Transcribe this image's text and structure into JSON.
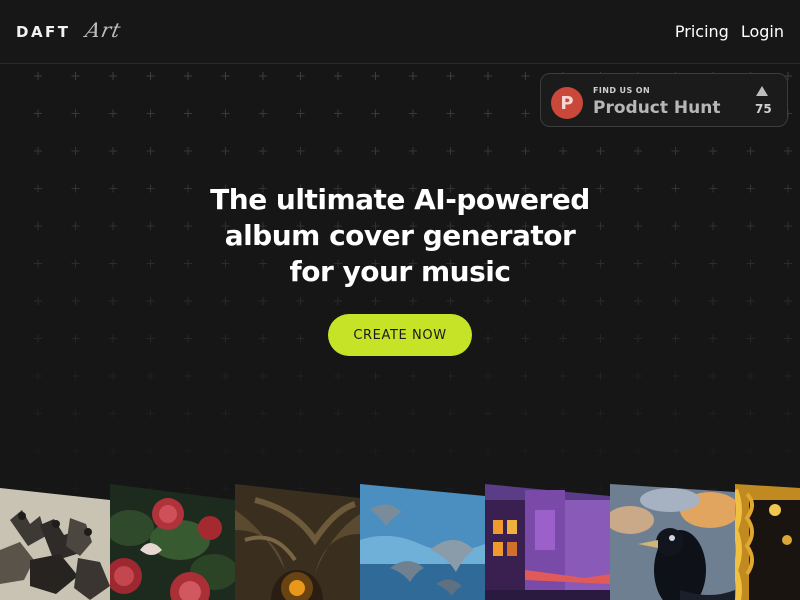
{
  "header": {
    "logo_main": "DAFT",
    "logo_script": "Art",
    "nav": [
      {
        "label": "Pricing"
      },
      {
        "label": "Login"
      }
    ]
  },
  "product_hunt": {
    "kicker": "FIND US ON",
    "name": "Product Hunt",
    "logo_letter": "P",
    "upvotes": "75"
  },
  "hero": {
    "title_line1": "The ultimate AI-powered",
    "title_line2": "album cover generator",
    "title_line3": "for your music",
    "cta_label": "CREATE NOW"
  },
  "albums": [
    {
      "name": "album-cover-battle-sketch"
    },
    {
      "name": "album-cover-roses"
    },
    {
      "name": "album-cover-forest-portal"
    },
    {
      "name": "album-cover-dolphins"
    },
    {
      "name": "album-cover-neon-city"
    },
    {
      "name": "album-cover-raven"
    },
    {
      "name": "album-cover-golden-frame"
    }
  ],
  "colors": {
    "background": "#161616",
    "accent": "#c6e328",
    "product_hunt": "#c9483a"
  }
}
